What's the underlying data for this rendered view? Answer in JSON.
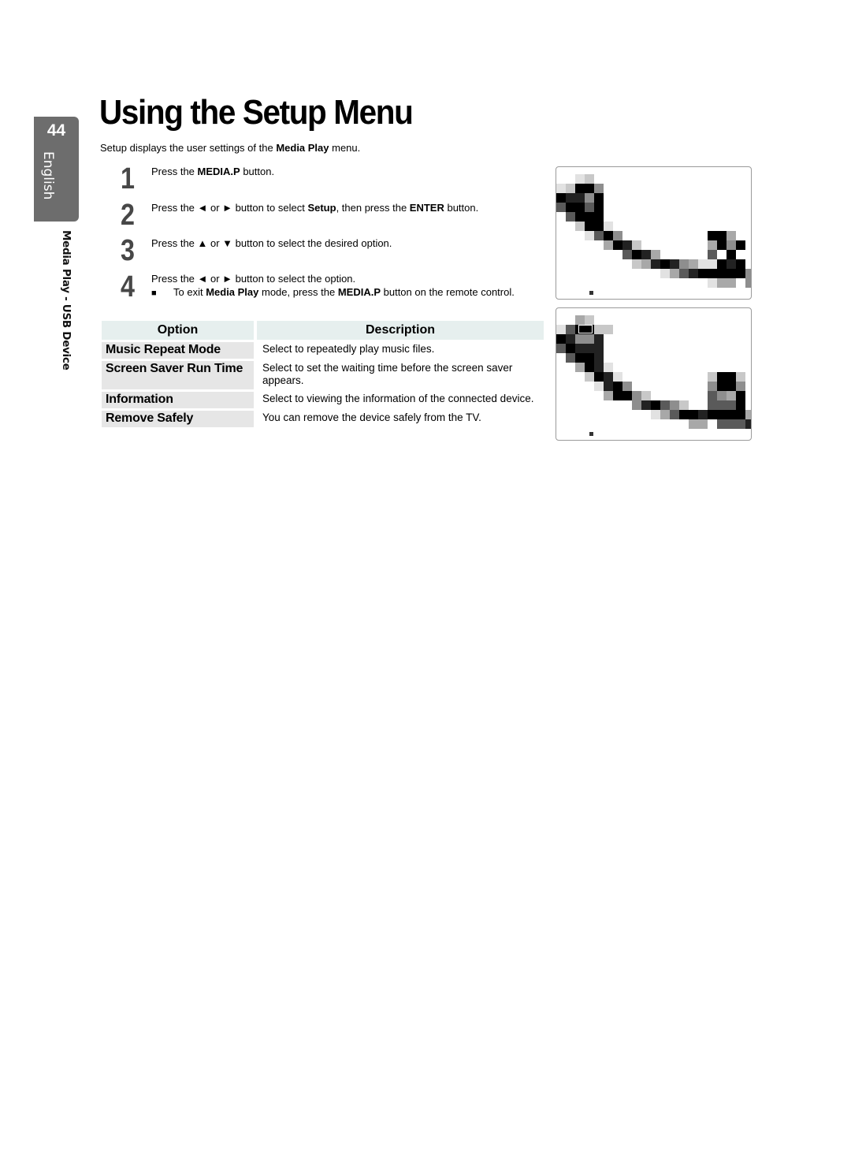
{
  "side_tab": {
    "page_number": "44",
    "language": "English"
  },
  "section_label": "Media Play - USB Device",
  "title": "Using the Setup Menu",
  "intro": {
    "before": "Setup displays the user settings of the ",
    "bold": "Media Play",
    "after": " menu."
  },
  "steps": [
    {
      "number": "1",
      "parts": [
        {
          "t": "Press the "
        },
        {
          "b": "MEDIA.P"
        },
        {
          "t": " button."
        }
      ]
    },
    {
      "number": "2",
      "parts": [
        {
          "t": "Press the ◄ or ► button to select "
        },
        {
          "b": "Setup"
        },
        {
          "t": ", then press the "
        },
        {
          "b": "ENTER"
        },
        {
          "t": "      button."
        }
      ]
    },
    {
      "number": "3",
      "parts": [
        {
          "t": "Press the ▲ or ▼ button to select the desired option."
        }
      ]
    },
    {
      "number": "4",
      "parts": [
        {
          "t": "Press the ◄ or ► button to select the option."
        }
      ]
    }
  ],
  "note": {
    "bullet": "■",
    "parts": [
      {
        "t": "To exit "
      },
      {
        "b": "Media Play"
      },
      {
        "t": " mode, press the "
      },
      {
        "b": "MEDIA.P"
      },
      {
        "t": " button on the remote control."
      }
    ]
  },
  "table": {
    "headers": [
      "Option",
      "Description"
    ],
    "rows": [
      {
        "option": "Music Repeat Mode",
        "description": "Select to repeatedly play music files."
      },
      {
        "option": "Screen Saver Run Time",
        "description": "Select to set the waiting time before the screen saver appears."
      },
      {
        "option": "Information",
        "description": "Select to viewing the information of the connected device."
      },
      {
        "option": "Remove Safely",
        "description": "You can remove the device safely from the TV."
      }
    ]
  },
  "screenshots": [
    {
      "name": "setup-menu-screenshot-1",
      "pixel_rows": [
        "..ed................",
        "edkkg...............",
        "kmmgk...............",
        "nkknk...............",
        ".nkkk...............",
        "..dkke..............",
        "...enkg.........kkf.",
        ".....fkmd.......fkgk",
        ".......nkmf.....nwk.",
        "........dfmkmgfeekmk",
        "...........efnmkkkkkg",
        "................eff.gn"
      ],
      "has_selection_box": false
    },
    {
      "name": "setup-menu-screenshot-2",
      "pixel_rows": [
        "..fd................",
        "enkkdd..............",
        "kmggm...............",
        "nkmmm...............",
        ".nkkm...............",
        "..fkme..............",
        "...dkme.........dkkd",
        "....emkg........gkkg",
        ".....fkkgd......ngfk",
        "........gmkngd..nnnk",
        "..........efnkkmkkkkf",
        "..............ff.nnnm"
      ],
      "has_selection_box": true
    }
  ],
  "gray_levels": {
    "k": "#000000",
    "m": "#222222",
    "n": "#5a5a5a",
    "g": "#8e8e8e",
    "f": "#a8a8a8",
    "d": "#c8c8c8",
    "e": "#e2e2e2",
    "w": "#ffffff"
  }
}
